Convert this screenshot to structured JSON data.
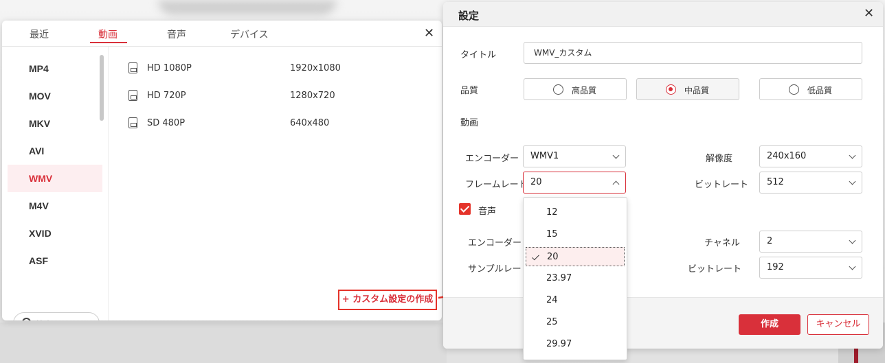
{
  "converter": {
    "tabs": [
      "最近",
      "動画",
      "音声",
      "デバイス"
    ],
    "active_tab": 1,
    "close_label": "✕",
    "formats": [
      "MP4",
      "MOV",
      "MKV",
      "AVI",
      "WMV",
      "M4V",
      "XVID",
      "ASF"
    ],
    "active_format": 4,
    "presets": [
      {
        "name": "HD 1080P",
        "resolution": "1920x1080"
      },
      {
        "name": "HD 720P",
        "resolution": "1280x720"
      },
      {
        "name": "SD 480P",
        "resolution": "640x480"
      }
    ],
    "search_placeholder": "検索",
    "create_custom_label": "+ カスタム設定の作成"
  },
  "settings": {
    "title": "設定",
    "close_label": "✕",
    "title_label": "タイトル",
    "title_value": "WMV_カスタム",
    "quality_label": "品質",
    "quality_options": [
      "高品質",
      "中品質",
      "低品質"
    ],
    "quality_selected": 1,
    "video_section": "動画",
    "video": {
      "encoder_label": "エンコーダー",
      "encoder_value": "WMV1",
      "resolution_label": "解像度",
      "resolution_value": "240x160",
      "framerate_label": "フレームレート",
      "framerate_value": "20",
      "bitrate_label": "ビットレート",
      "bitrate_value": "512"
    },
    "audio_section": "音声",
    "audio_checked": true,
    "audio": {
      "encoder_label": "エンコーダー",
      "channel_label": "チャネル",
      "channel_value": "2",
      "samplerate_label": "サンプルレート",
      "bitrate_label": "ビットレート",
      "bitrate_value": "192"
    },
    "create_label": "作成",
    "cancel_label": "キャンセル"
  },
  "framerate_dropdown": {
    "options": [
      "12",
      "15",
      "20",
      "23.97",
      "24",
      "25",
      "29.97"
    ],
    "selected_index": 2
  },
  "colors": {
    "accent": "#d9303a",
    "highlight_border": "#e5332a"
  }
}
